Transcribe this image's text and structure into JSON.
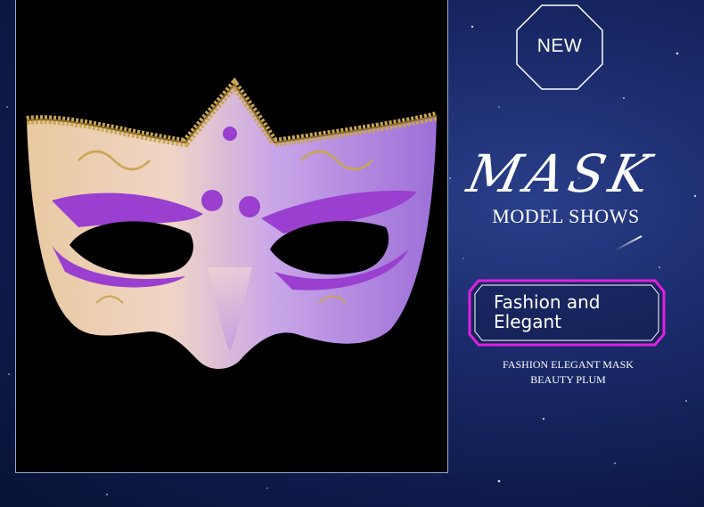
{
  "badge": {
    "label": "NEW",
    "icon": "octagon-badge-icon"
  },
  "hero": {
    "script_title": "MASK",
    "subtitle": "MODEL SHOWS"
  },
  "tag": {
    "line1": "Fashion and",
    "line2": "Elegant",
    "border_color": "#e020e0"
  },
  "caption": {
    "line1": "FASHION ELEGANT MASK",
    "line2": "BEAUTY PLUM"
  },
  "product_image": {
    "subject": "purple and gold masquerade mask"
  },
  "colors": {
    "background": "#13205a",
    "accent": "#e020e0",
    "mask_purple": "#9a3fd0",
    "mask_gold": "#c9a652"
  }
}
